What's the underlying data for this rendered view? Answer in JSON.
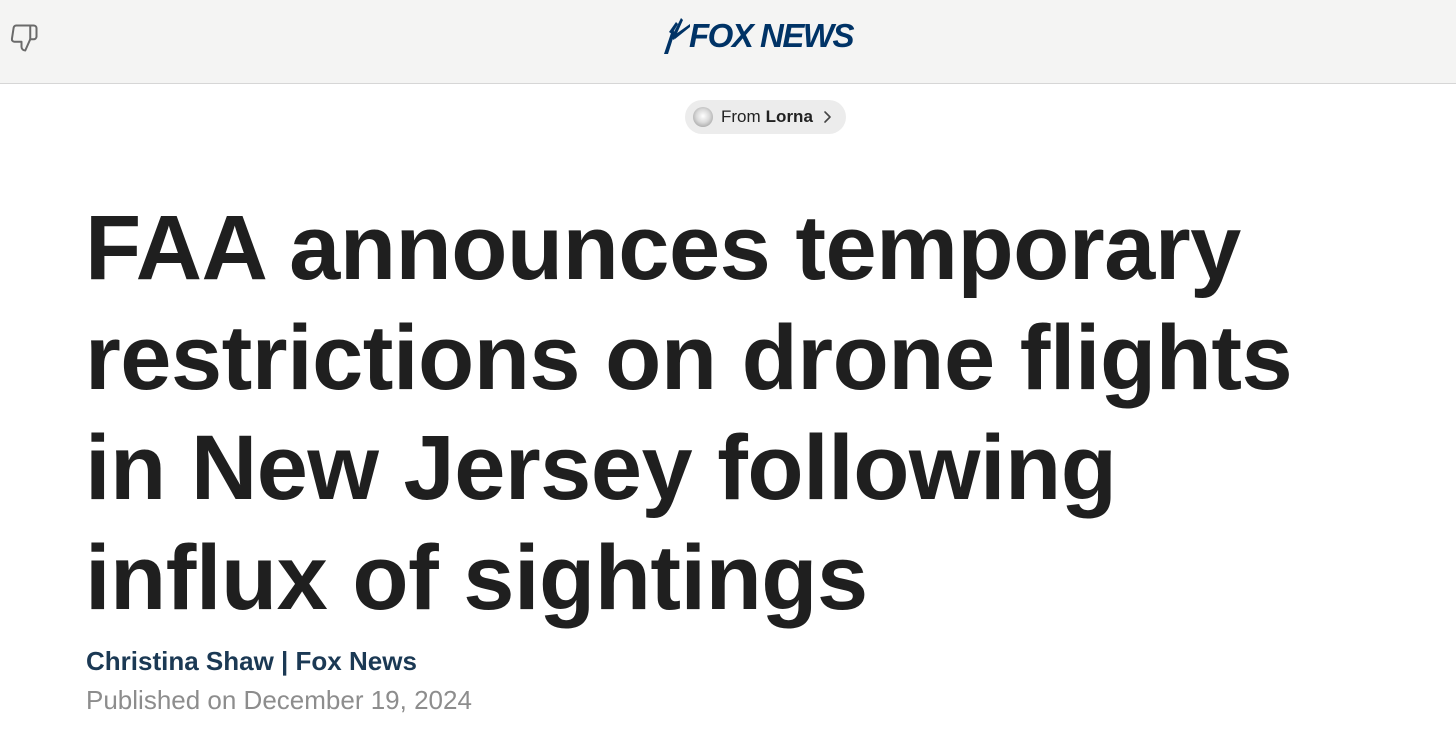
{
  "header": {
    "brand": "FOX NEWS",
    "brand_color": "#003366",
    "dislike_icon": "thumbs-down-icon"
  },
  "source_pill": {
    "prefix": "From",
    "name": "Lorna",
    "chevron_icon": "chevron-right-icon"
  },
  "article": {
    "headline_lines": [
      "FAA announces temporary",
      "restrictions on drone flights",
      "in New Jersey following",
      "influx of sightings"
    ],
    "byline": "Christina Shaw | Fox News",
    "published": "Published on December 19, 2024"
  }
}
